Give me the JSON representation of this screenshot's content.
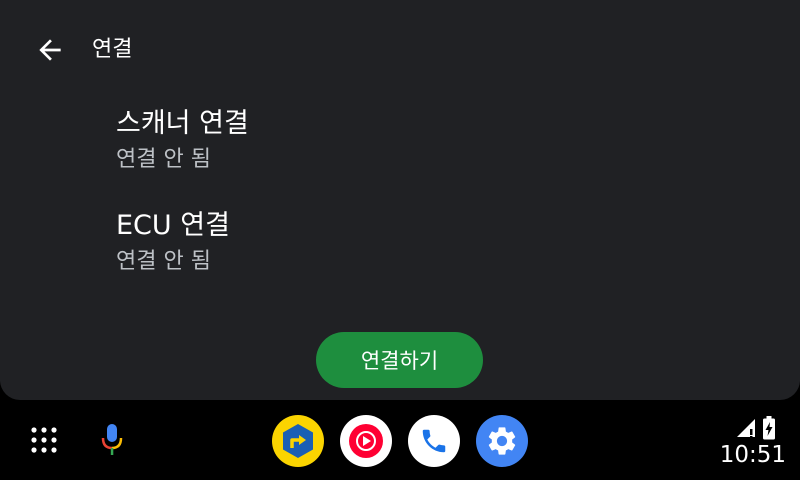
{
  "header": {
    "back_icon": "arrow-back-icon",
    "title": "연결"
  },
  "items": [
    {
      "title": "스캐너 연결",
      "status": "연결 안 됨"
    },
    {
      "title": "ECU 연결",
      "status": "연결 안 됨"
    }
  ],
  "connect_button": {
    "label": "연결하기",
    "color": "#1e8e3e"
  },
  "dock": {
    "launcher_icon": "app-grid-icon",
    "assistant_icon": "microphone-icon",
    "apps": [
      {
        "name": "navigation-app-icon",
        "bg": "#fbd400"
      },
      {
        "name": "youtube-music-icon",
        "bg": "#ffffff"
      },
      {
        "name": "phone-app-icon",
        "bg": "#ffffff"
      },
      {
        "name": "settings-app-icon",
        "bg": "#4285f4"
      }
    ]
  },
  "status_bar": {
    "signal_icon": "cell-signal-icon",
    "battery_icon": "battery-charging-icon",
    "time": "10:51"
  }
}
